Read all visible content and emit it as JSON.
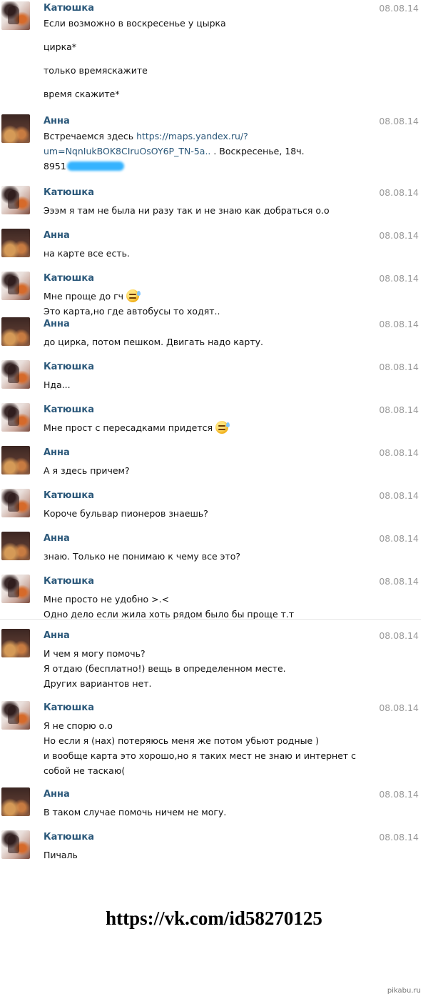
{
  "messages": [
    {
      "author": "Катюшка",
      "date": "08.08.14",
      "lines": [
        "Если возможно в воскресенье у цырка",
        "цирка*",
        "только времяскажите",
        "время скажите*"
      ]
    },
    {
      "author": "Анна",
      "date": "08.08.14",
      "lines": [
        "Встречаемся здесь ",
        "https://maps.yandex.ru/?",
        "um=NqnIukBOK8CIruOsOY6P_TN-5a..",
        " . Воскресенье, 18ч.",
        "8951"
      ]
    },
    {
      "author": "Катюшка",
      "date": "08.08.14",
      "lines": [
        "Эээм я там не была ни разу так и не знаю как добраться о.о"
      ]
    },
    {
      "author": "Анна",
      "date": "08.08.14",
      "lines": [
        "на карте все есть."
      ]
    },
    {
      "author": "Катюшка",
      "date": "08.08.14",
      "lines": [
        "Мне проще до гч",
        "Это карта,но где автобусы то ходят.."
      ]
    },
    {
      "author": "Анна",
      "date": "08.08.14",
      "lines": [
        "до цирка, потом пешком. Двигать надо карту."
      ]
    },
    {
      "author": "Катюшка",
      "date": "08.08.14",
      "lines": [
        "Нда..."
      ]
    },
    {
      "author": "Катюшка",
      "date": "08.08.14",
      "lines": [
        "Мне прост с пересадками придется"
      ]
    },
    {
      "author": "Анна",
      "date": "08.08.14",
      "lines": [
        "А я здесь причем?"
      ]
    },
    {
      "author": "Катюшка",
      "date": "08.08.14",
      "lines": [
        "Короче бульвар пионеров знаешь?"
      ]
    },
    {
      "author": "Анна",
      "date": "08.08.14",
      "lines": [
        "знаю. Только не понимаю к чему все это?"
      ]
    },
    {
      "author": "Катюшка",
      "date": "08.08.14",
      "lines": [
        "Мне просто не удобно >.<",
        "Одно дело если жила хоть рядом было бы проще т.т"
      ]
    },
    {
      "author": "Анна",
      "date": "08.08.14",
      "lines": [
        "И чем я могу помочь?",
        "Я отдаю (бесплатно!) вещь в определенном месте.",
        "Других вариантов нет."
      ]
    },
    {
      "author": "Катюшка",
      "date": "08.08.14",
      "lines": [
        "Я не спорю о.о",
        "Но если я (нах) потеряюсь меня же потом убьют родные )",
        "и вообще карта это хорошо,но я таких мест не знаю и интернет с",
        "собой не таскаю("
      ]
    },
    {
      "author": "Анна",
      "date": "08.08.14",
      "lines": [
        "В таком случае помочь ничем не могу."
      ]
    },
    {
      "author": "Катюшка",
      "date": "08.08.14",
      "lines": [
        "Пичаль"
      ]
    }
  ],
  "icons": {
    "emoji": "sweat-smile-emoji-icon"
  },
  "footer": {
    "vk_link": "https://vk.com/id58270125",
    "watermark": "pikabu.ru"
  },
  "colors": {
    "author": "#2b587a",
    "date": "#999999",
    "link": "#2b587a",
    "redaction": "#35b3ff"
  }
}
